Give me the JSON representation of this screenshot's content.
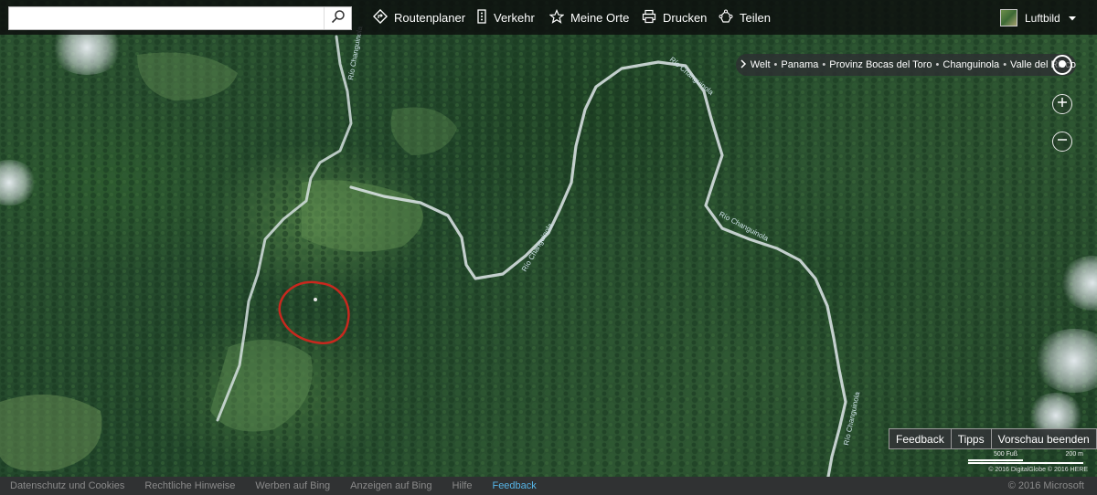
{
  "search": {
    "value": "",
    "placeholder": ""
  },
  "toolbar": {
    "items": [
      {
        "label": "Routenplaner",
        "icon": "route-icon"
      },
      {
        "label": "Verkehr",
        "icon": "traffic-icon"
      },
      {
        "label": "Meine Orte",
        "icon": "star-icon"
      },
      {
        "label": "Drucken",
        "icon": "print-icon"
      },
      {
        "label": "Teilen",
        "icon": "share-icon"
      }
    ],
    "map_style": "Luftbild"
  },
  "breadcrumb": {
    "items": [
      "Welt",
      "Panama",
      "Provinz Bocas del Toro",
      "Changuinola",
      "Valle del Risco"
    ]
  },
  "map_labels": {
    "river_1": "Río Changuinola",
    "river_2": "Río Changuinola",
    "river_3": "Río Changuinola",
    "river_4": "Río Changuinola",
    "river_5": "Río Changuinola"
  },
  "preview": {
    "feedback": "Feedback",
    "tips": "Tipps",
    "end_preview": "Vorschau beenden"
  },
  "scale": {
    "imperial": "500 Fuß",
    "metric": "200 m"
  },
  "map_copyright": "© 2016 DigitalGlobe © 2016 HERE",
  "footer": {
    "links": [
      "Datenschutz und Cookies",
      "Rechtliche Hinweise",
      "Werben auf Bing",
      "Anzeigen auf Bing",
      "Hilfe",
      "Feedback"
    ],
    "copyright": "© 2016 Microsoft"
  },
  "colors": {
    "annotation": "#c8281e",
    "river": "#dfe8ea",
    "footer_link_active": "#56b4e6"
  }
}
